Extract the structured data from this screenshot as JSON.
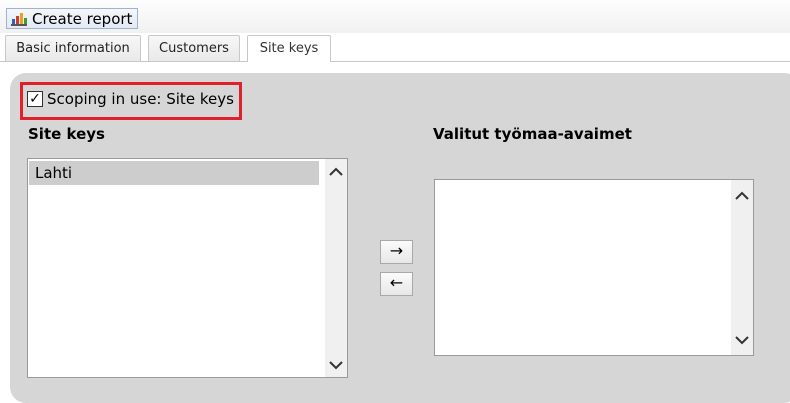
{
  "toolbar": {
    "create_report_label": "Create report",
    "create_report_icon": "bar-chart-icon"
  },
  "tabs": [
    {
      "label": "Basic information"
    },
    {
      "label": "Customers"
    },
    {
      "label": "Site keys",
      "active": true
    }
  ],
  "scoping": {
    "label": "Scoping in use: Site keys",
    "checked": true,
    "check_glyph": "✓"
  },
  "available": {
    "heading": "Site keys",
    "items": [
      "Lahti"
    ]
  },
  "selected": {
    "heading": "Valitut työmaa-avaimet",
    "items": []
  },
  "move_buttons": {
    "add": "→",
    "remove": "←"
  },
  "colors": {
    "highlight": "#e0202a",
    "panel": "#d6d6d6",
    "selected_item": "#cdcdcd"
  }
}
